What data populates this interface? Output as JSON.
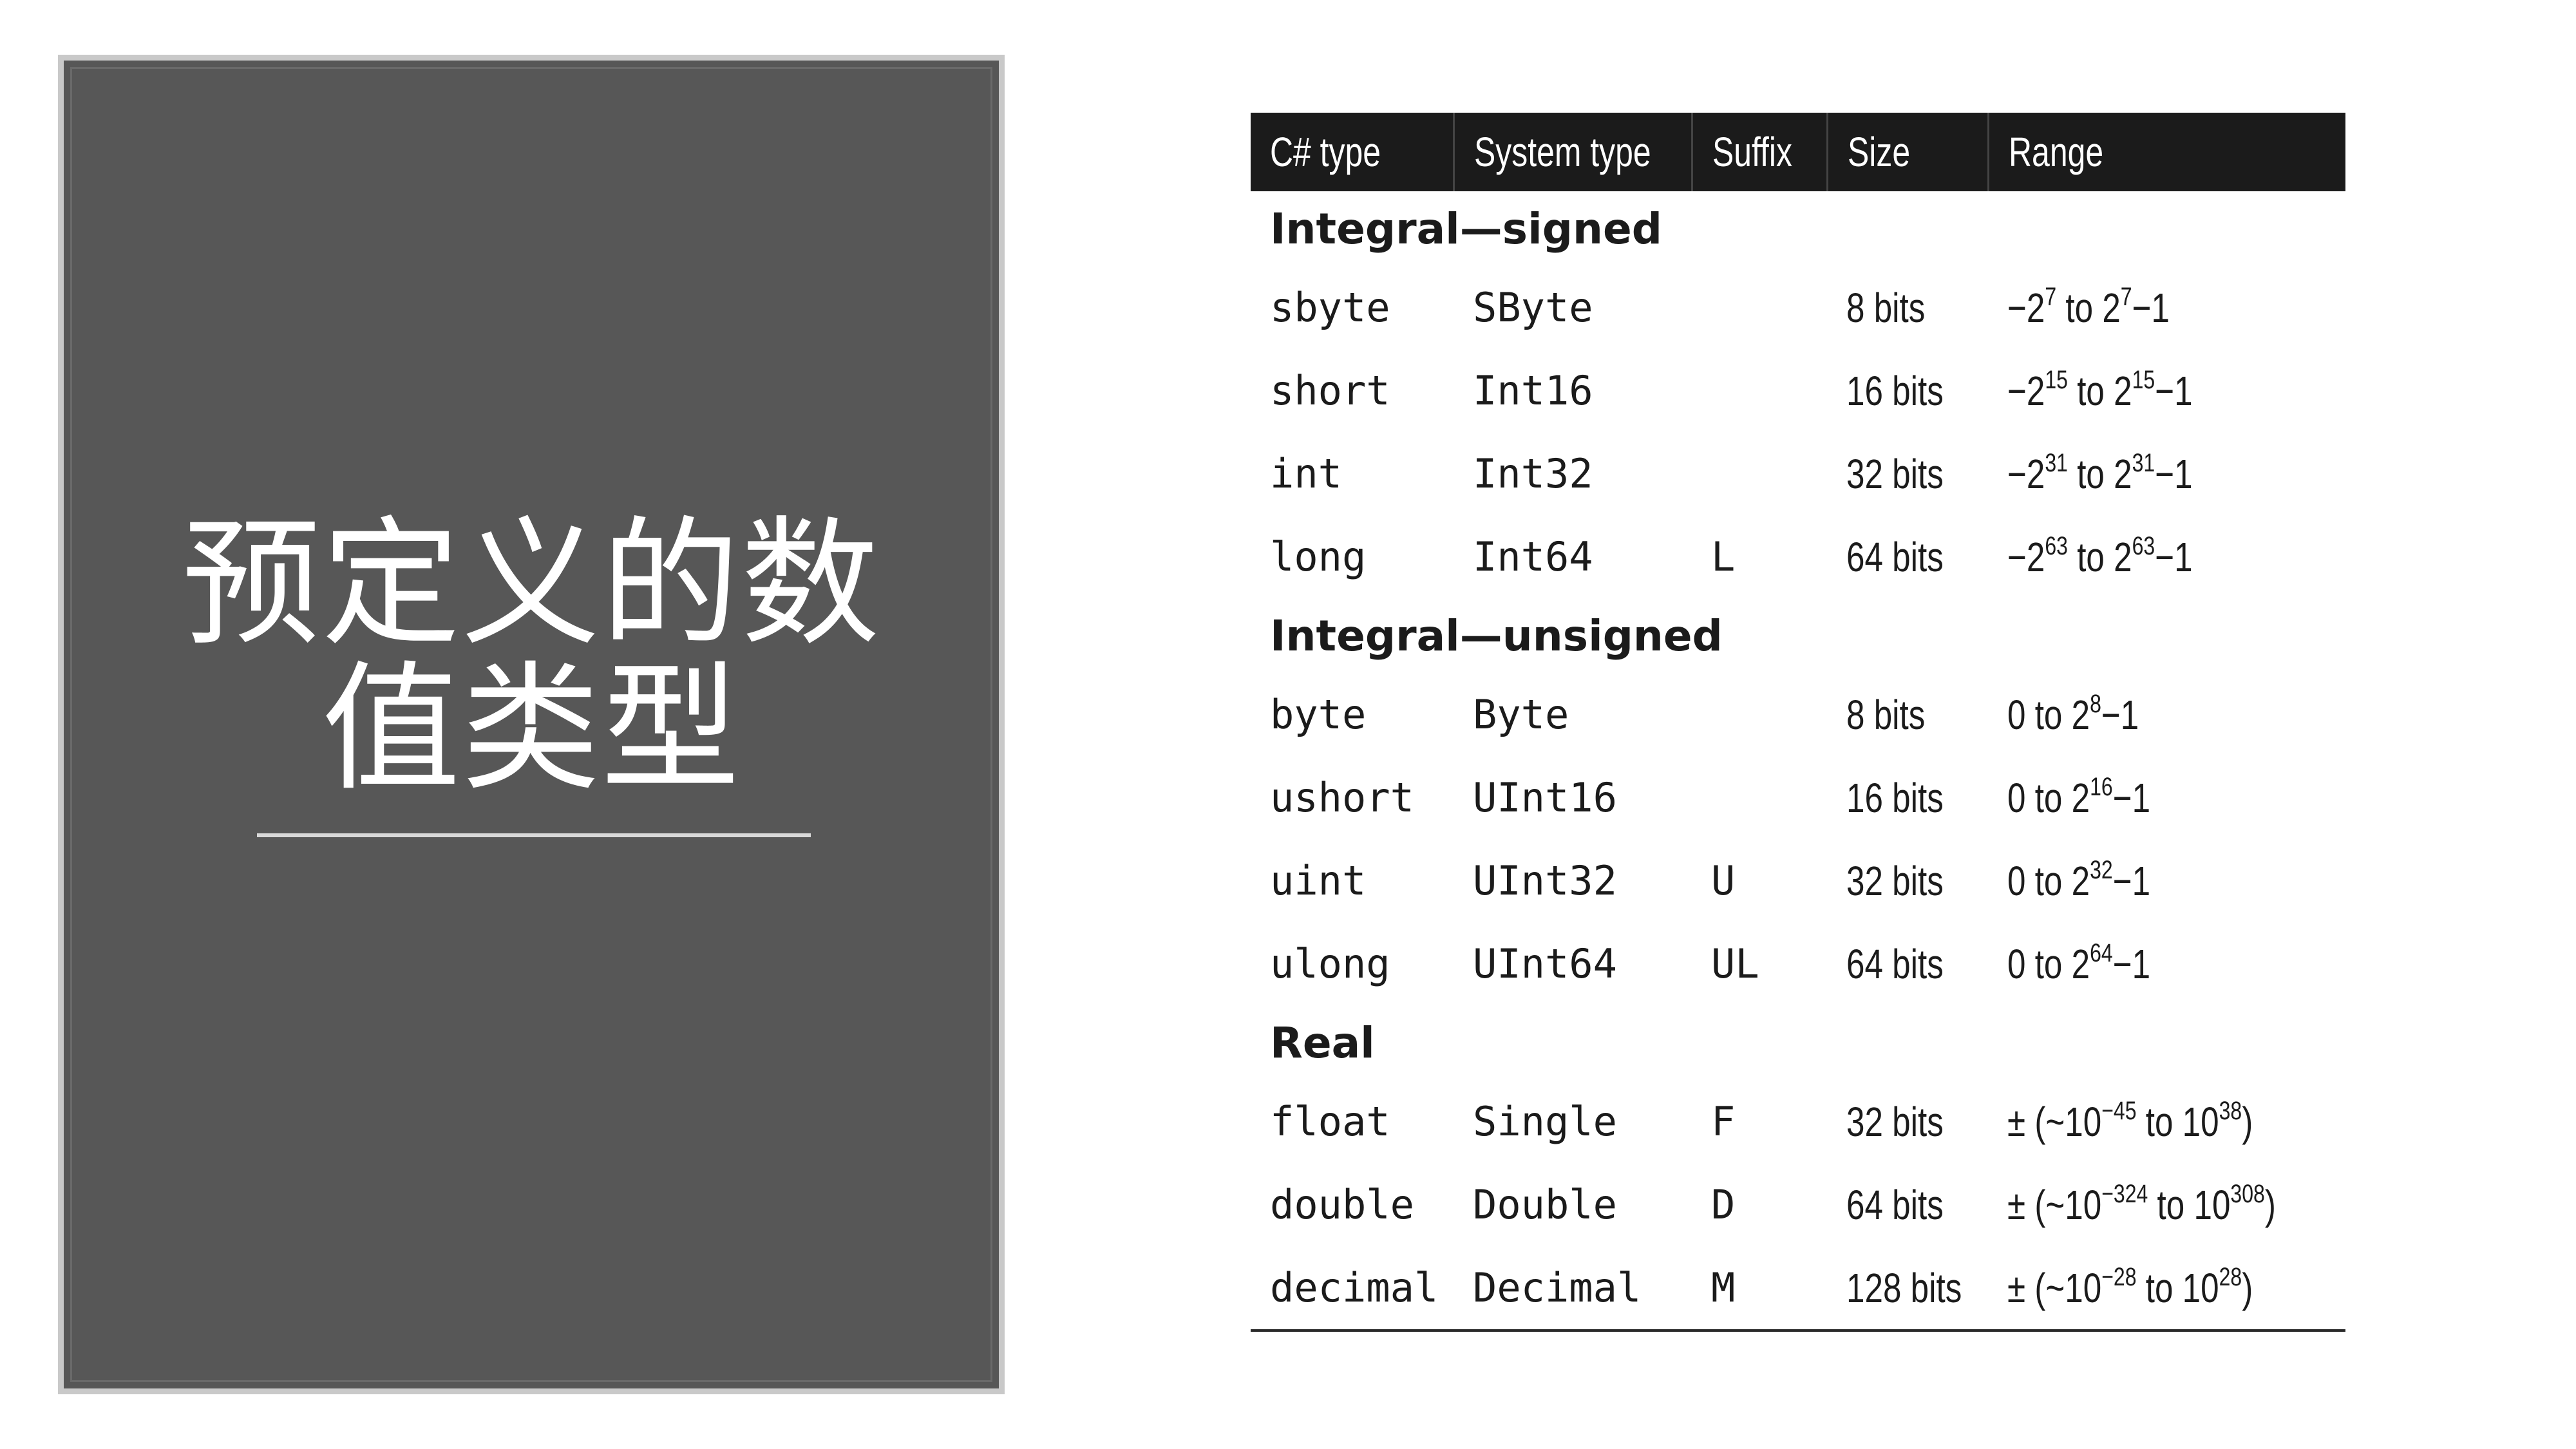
{
  "slide": {
    "title": "预定义的数\n值类型"
  },
  "table": {
    "headers": [
      "C# type",
      "System type",
      "Suffix",
      "Size",
      "Range"
    ],
    "groups": [
      {
        "label": "Integral—signed",
        "rows": [
          {
            "cs": "sbyte",
            "sys": "SByte",
            "suffix": "",
            "size": "8 bits",
            "range": {
              "a": "−2",
              "e1": "7",
              "b": " to 2",
              "e2": "7",
              "c": "−1"
            }
          },
          {
            "cs": "short",
            "sys": "Int16",
            "suffix": "",
            "size": "16 bits",
            "range": {
              "a": "−2",
              "e1": "15",
              "b": " to 2",
              "e2": "15",
              "c": "−1"
            }
          },
          {
            "cs": "int",
            "sys": "Int32",
            "suffix": "",
            "size": "32 bits",
            "range": {
              "a": "−2",
              "e1": "31",
              "b": " to 2",
              "e2": "31",
              "c": "−1"
            }
          },
          {
            "cs": "long",
            "sys": "Int64",
            "suffix": "L",
            "size": "64 bits",
            "range": {
              "a": "−2",
              "e1": "63",
              "b": " to 2",
              "e2": "63",
              "c": "−1"
            }
          }
        ]
      },
      {
        "label": "Integral—unsigned",
        "rows": [
          {
            "cs": "byte",
            "sys": "Byte",
            "suffix": "",
            "size": "8 bits",
            "range": {
              "a": "0 to 2",
              "e1": "8",
              "b": "−1",
              "e2": "",
              "c": ""
            }
          },
          {
            "cs": "ushort",
            "sys": "UInt16",
            "suffix": "",
            "size": "16 bits",
            "range": {
              "a": "0 to 2",
              "e1": "16",
              "b": "−1",
              "e2": "",
              "c": ""
            }
          },
          {
            "cs": "uint",
            "sys": "UInt32",
            "suffix": "U",
            "size": "32 bits",
            "range": {
              "a": "0 to 2",
              "e1": "32",
              "b": "−1",
              "e2": "",
              "c": ""
            }
          },
          {
            "cs": "ulong",
            "sys": "UInt64",
            "suffix": "UL",
            "size": "64 bits",
            "range": {
              "a": "0 to 2",
              "e1": "64",
              "b": "−1",
              "e2": "",
              "c": ""
            }
          }
        ]
      },
      {
        "label": "Real",
        "rows": [
          {
            "cs": "float",
            "sys": "Single",
            "suffix": "F",
            "size": "32 bits",
            "range": {
              "a": "± (~10",
              "e1": "−45",
              "b": " to 10",
              "e2": "38",
              "c": ")"
            }
          },
          {
            "cs": "double",
            "sys": "Double",
            "suffix": "D",
            "size": "64 bits",
            "range": {
              "a": "± (~10",
              "e1": "−324",
              "b": " to 10",
              "e2": "308",
              "c": ")"
            }
          },
          {
            "cs": "decimal",
            "sys": "Decimal",
            "suffix": "M",
            "size": "128 bits",
            "range": {
              "a": "± (~10",
              "e1": "−28",
              "b": " to 10",
              "e2": "28",
              "c": ")"
            }
          }
        ]
      }
    ]
  }
}
